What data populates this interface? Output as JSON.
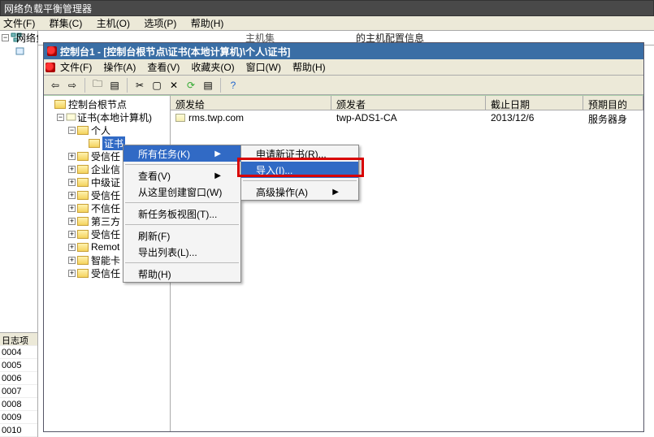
{
  "outer": {
    "title": "网络负载平衡管理器",
    "menu": [
      "文件(F)",
      "群集(C)",
      "主机(O)",
      "选项(P)",
      "帮助(H)"
    ],
    "tree_root": "网络负载平衡群集",
    "log_header": "日志项"
  },
  "rownums": [
    "0004",
    "0005",
    "0006",
    "0007",
    "0008",
    "0009",
    "0010"
  ],
  "host_line_partial": "的主机配置信息",
  "inner": {
    "title": "控制台1 - [控制台根节点\\证书(本地计算机)\\个人\\证书]",
    "menu": [
      "文件(F)",
      "操作(A)",
      "查看(V)",
      "收藏夹(O)",
      "窗口(W)",
      "帮助(H)"
    ],
    "toolbar_icons": [
      "back-arrow",
      "forward-arrow",
      "up-arrow",
      "cut-icon",
      "copy-icon",
      "delete-icon",
      "refresh-icon",
      "properties-icon",
      "export-icon",
      "help-icon"
    ]
  },
  "tree": {
    "root": "控制台根节点",
    "cert_root": "证书(本地计算机)",
    "nodes": [
      {
        "label": "个人",
        "open": true
      },
      {
        "label": "证书",
        "selected": true
      },
      {
        "label": "受信任"
      },
      {
        "label": "企业信"
      },
      {
        "label": "中级证"
      },
      {
        "label": "受信任"
      },
      {
        "label": "不信任"
      },
      {
        "label": "第三方"
      },
      {
        "label": "受信任"
      },
      {
        "label": "Remot"
      },
      {
        "label": "智能卡"
      },
      {
        "label": "受信任"
      }
    ]
  },
  "columns": {
    "c1": "颁发给",
    "c2": "颁发者",
    "c3": "截止日期",
    "c4": "预期目的"
  },
  "rows": [
    {
      "to": "rms.twp.com",
      "by": "twp-ADS1-CA",
      "date": "2013/12/6",
      "purpose": "服务器身"
    }
  ],
  "ctx1": {
    "all_tasks": "所有任务(K)",
    "view": "查看(V)",
    "new_window": "从这里创建窗口(W)",
    "new_taskpad": "新任务板视图(T)...",
    "refresh": "刷新(F)",
    "export": "导出列表(L)...",
    "help": "帮助(H)"
  },
  "ctx2": {
    "request": "申请新证书(R)...",
    "import": "导入(I)...",
    "advanced": "高级操作(A)"
  }
}
